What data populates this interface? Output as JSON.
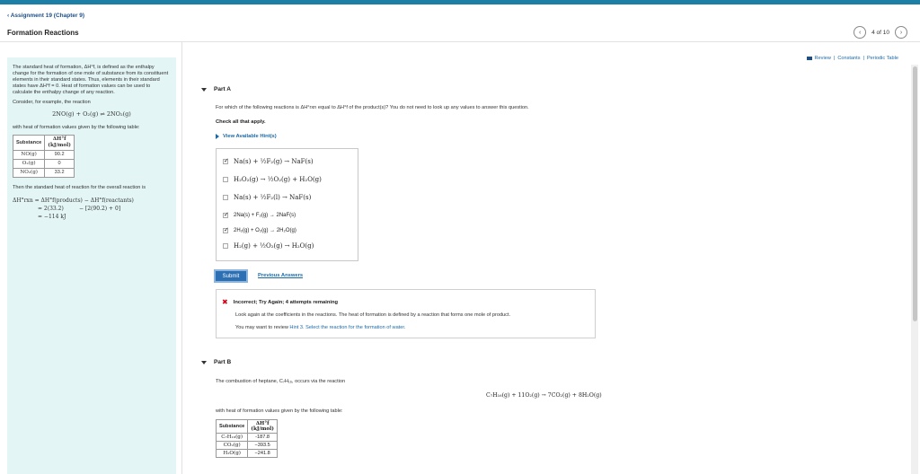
{
  "header": {
    "back_label": "Assignment 19 (Chapter 9)",
    "title": "Formation Reactions",
    "pager": "4 of 10",
    "prev_glyph": "‹",
    "next_glyph": "›"
  },
  "toplinks": {
    "review": "Review",
    "sep1": "|",
    "constants": "Constants",
    "sep2": "|",
    "periodic": "Periodic Table"
  },
  "left": {
    "intro": "The standard heat of formation, ΔH°f, is defined as the enthalpy change for the formation of one mole of substance from its constituent elements in their standard states. Thus, elements in their standard states have ΔH°f = 0. Heat of formation values can be used to calculate the enthalpy change of any reaction.",
    "consider": "Consider, for example, the reaction",
    "reaction": "2NO(g) + O₂(g) ⇌ 2NO₂(g)",
    "with_heat": "with heat of formation values given by the following table:",
    "table": {
      "col1": "Substance",
      "col2_top": "ΔH°f",
      "col2_bottom": "(kJ/mol)",
      "rows": [
        {
          "substance": "NO(g)",
          "value": "90.2"
        },
        {
          "substance": "O₂(g)",
          "value": "0"
        },
        {
          "substance": "NO₂(g)",
          "value": "33.2"
        }
      ]
    },
    "then": "Then the standard heat of reaction for the overall reaction is",
    "calc": {
      "line1_lhs": "ΔH°rxn",
      "line1_rhs": "= ΔH°f(products) − ΔH°f(reactants)",
      "line2_a": "= 2(33.2)",
      "line2_b": "− [2(90.2) + 0]",
      "line3": "= −114 kJ"
    }
  },
  "partA": {
    "label": "Part A",
    "question": "For which of the following reactions is ΔH°rxn equal to ΔH°f of the product(s)? You do not need to look up any values to answer this question.",
    "check_all": "Check all that apply.",
    "hint": "View Available Hint(s)",
    "options": [
      {
        "text": "Na(s) + ½F₂(g) → NaF(s)",
        "checked": true
      },
      {
        "text": "H₂O₂(g) → ½O₂(g) + H₂O(g)",
        "checked": false
      },
      {
        "text": "Na(s) + ½F₂(l) → NaF(s)",
        "checked": false
      },
      {
        "text": "2Na(s) + F₂(g) → 2NaF(s)",
        "checked": true
      },
      {
        "text": "2H₂(g) + O₂(g) → 2H₂O(g)",
        "checked": true
      },
      {
        "text": "H₂(g) + ½O₂(g) → H₂O(g)",
        "checked": false
      }
    ],
    "submit": "Submit",
    "previous_answers": "Previous Answers",
    "feedback": {
      "icon": "✖",
      "title": "Incorrect; Try Again; 4 attempts remaining",
      "line1": "Look again at the coefficients in the reactions. The heat of formation is defined by a reaction that forms one mole of product.",
      "line2_pre": "You may want to review ",
      "line2_link": "Hint 3. Select the reaction for the formation of water.",
      "line2_post": ""
    }
  },
  "partB": {
    "label": "Part B",
    "question": "The combustion of heptane, C₇H₁₆, occurs via the reaction",
    "reaction": "C₇H₁₆(g) + 11O₂(g) → 7CO₂(g) + 8H₂O(g)",
    "with_heat": "with heat of formation values given by the following table:",
    "table": {
      "col1": "Substance",
      "col2_top": "ΔH°f",
      "col2_bottom": "(kJ/mol)",
      "rows": [
        {
          "substance": "C₇H₁₆(g)",
          "value": "-187.8"
        },
        {
          "substance": "CO₂(g)",
          "value": "−393.5"
        },
        {
          "substance": "H₂O(g)",
          "value": "−241.8"
        }
      ]
    }
  }
}
